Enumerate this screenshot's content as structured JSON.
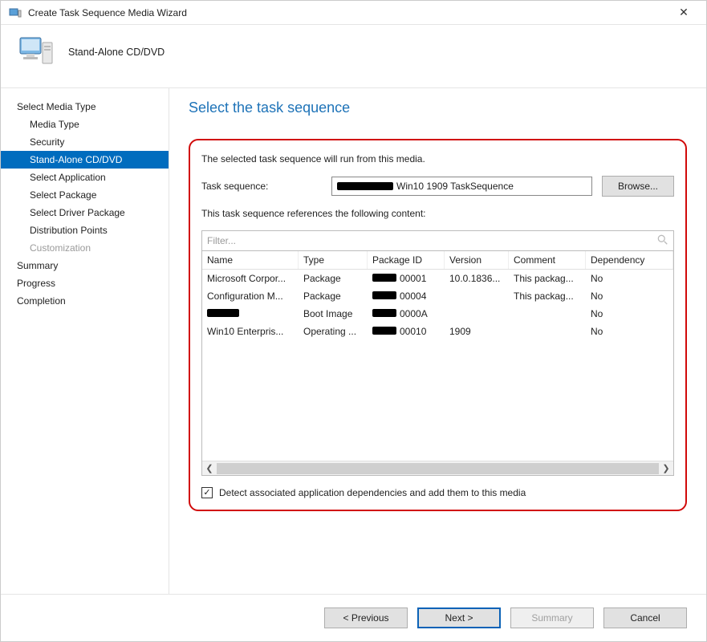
{
  "window": {
    "title": "Create Task Sequence Media Wizard",
    "header_title": "Stand-Alone CD/DVD"
  },
  "nav": {
    "items": [
      {
        "label": "Select Media Type",
        "level": 0,
        "active": false,
        "disabled": false
      },
      {
        "label": "Media Type",
        "level": 1,
        "active": false,
        "disabled": false
      },
      {
        "label": "Security",
        "level": 1,
        "active": false,
        "disabled": false
      },
      {
        "label": "Stand-Alone CD/DVD",
        "level": 1,
        "active": true,
        "disabled": false
      },
      {
        "label": "Select Application",
        "level": 1,
        "active": false,
        "disabled": false
      },
      {
        "label": "Select Package",
        "level": 1,
        "active": false,
        "disabled": false
      },
      {
        "label": "Select Driver Package",
        "level": 1,
        "active": false,
        "disabled": false
      },
      {
        "label": "Distribution Points",
        "level": 1,
        "active": false,
        "disabled": false
      },
      {
        "label": "Customization",
        "level": 1,
        "active": false,
        "disabled": true
      },
      {
        "label": "Summary",
        "level": 0,
        "active": false,
        "disabled": false
      },
      {
        "label": "Progress",
        "level": 0,
        "active": false,
        "disabled": false
      },
      {
        "label": "Completion",
        "level": 0,
        "active": false,
        "disabled": false
      }
    ]
  },
  "main": {
    "title": "Select the task sequence",
    "info_line": "The selected task sequence will run from this media.",
    "ts_label": "Task sequence:",
    "ts_value_prefix_redacted_width": 70,
    "ts_value_suffix": "Win10 1909 TaskSequence",
    "browse_label": "Browse...",
    "ref_line": "This task sequence references the following content:",
    "filter_placeholder": "Filter...",
    "columns": {
      "name": "Name",
      "type": "Type",
      "pkg": "Package ID",
      "ver": "Version",
      "com": "Comment",
      "dep": "Dependency"
    },
    "rows": [
      {
        "name": "Microsoft Corpor...",
        "type": "Package",
        "pkg_redact": 30,
        "pkg_suffix": "00001",
        "ver": "10.0.1836...",
        "com": "This packag...",
        "dep": "No"
      },
      {
        "name": "Configuration M...",
        "type": "Package",
        "pkg_redact": 30,
        "pkg_suffix": "00004",
        "ver": "",
        "com": "This packag...",
        "dep": "No"
      },
      {
        "name_redact": 40,
        "type": "Boot Image",
        "pkg_redact": 30,
        "pkg_suffix": "0000A",
        "ver": "",
        "com": "",
        "dep": "No"
      },
      {
        "name": "Win10 Enterpris...",
        "type": "Operating ...",
        "pkg_redact": 30,
        "pkg_suffix": "00010",
        "ver": "1909",
        "com": "",
        "dep": "No"
      }
    ],
    "checkbox_label": "Detect associated application dependencies and add them to this media",
    "checkbox_checked": true
  },
  "footer": {
    "previous": "< Previous",
    "next": "Next >",
    "summary": "Summary",
    "cancel": "Cancel"
  }
}
